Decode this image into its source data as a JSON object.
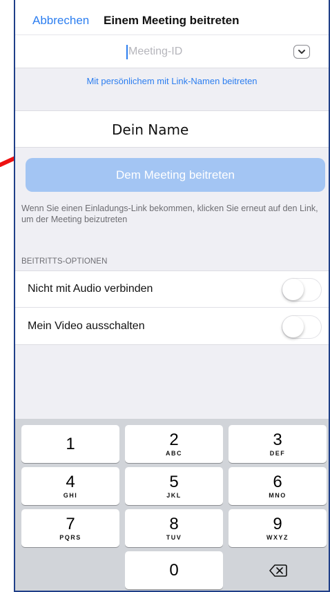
{
  "navbar": {
    "cancel_label": "Abbrechen",
    "title": "Einem Meeting beitreten"
  },
  "meeting_id": {
    "placeholder": "Meeting-ID",
    "value": "",
    "dropdown_icon": "chevron-down-icon"
  },
  "personal_link_label": "Mit persönlichem mit Link-Namen beitreten",
  "name_field": {
    "placeholder": "Dein Name",
    "value": ""
  },
  "join_button_label": "Dem Meeting beitreten",
  "hint_text": "Wenn Sie einen Einladungs-Link bekommen, klicken Sie erneut auf den Link, um der Meeting beizutreten",
  "options_header": "BEITRITTS-OPTIONEN",
  "options": [
    {
      "label": "Nicht mit Audio verbinden",
      "enabled": false
    },
    {
      "label": "Mein Video ausschalten",
      "enabled": false
    }
  ],
  "keypad": [
    {
      "digit": "1",
      "letters": ""
    },
    {
      "digit": "2",
      "letters": "ABC"
    },
    {
      "digit": "3",
      "letters": "DEF"
    },
    {
      "digit": "4",
      "letters": "GHI"
    },
    {
      "digit": "5",
      "letters": "JKL"
    },
    {
      "digit": "6",
      "letters": "MNO"
    },
    {
      "digit": "7",
      "letters": "PQRS"
    },
    {
      "digit": "8",
      "letters": "TUV"
    },
    {
      "digit": "9",
      "letters": "WXYZ"
    },
    {
      "digit": "0",
      "letters": ""
    }
  ],
  "backspace_icon": "backspace-icon",
  "colors": {
    "accent": "#2c7ef0",
    "join_button_disabled": "#a3c5f3",
    "annotation_arrow": "#ee1111",
    "frame": "#1f3f88"
  }
}
